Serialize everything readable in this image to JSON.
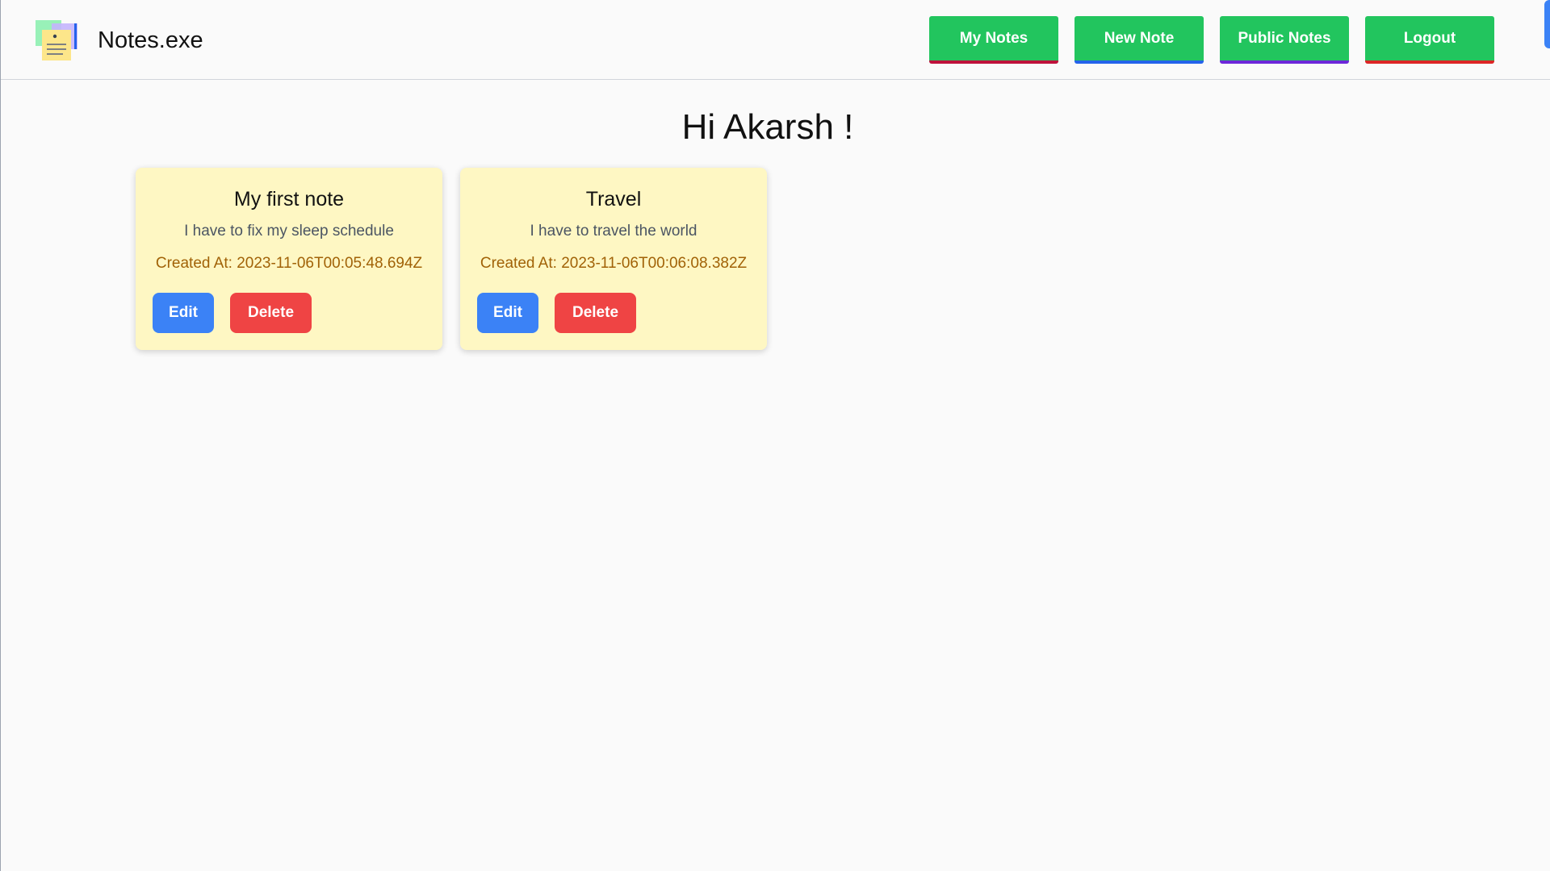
{
  "header": {
    "brand": "Notes.exe",
    "nav": [
      {
        "label": "My Notes"
      },
      {
        "label": "New Note"
      },
      {
        "label": "Public Notes"
      },
      {
        "label": "Logout"
      }
    ]
  },
  "greeting": "Hi Akarsh !",
  "notes": [
    {
      "title": "My first note",
      "description": "I have to fix my sleep schedule",
      "created": "Created At: 2023-11-06T00:05:48.694Z",
      "edit_label": "Edit",
      "delete_label": "Delete"
    },
    {
      "title": "Travel",
      "description": "I have to travel the world",
      "created": "Created At: 2023-11-06T00:06:08.382Z",
      "edit_label": "Edit",
      "delete_label": "Delete"
    }
  ],
  "colors": {
    "nav_button": "#22c55e",
    "edit_button": "#3b82f6",
    "delete_button": "#ef4444",
    "card_background": "#fef7c3"
  },
  "icons": {
    "logo": "sticky-notes-icon"
  }
}
